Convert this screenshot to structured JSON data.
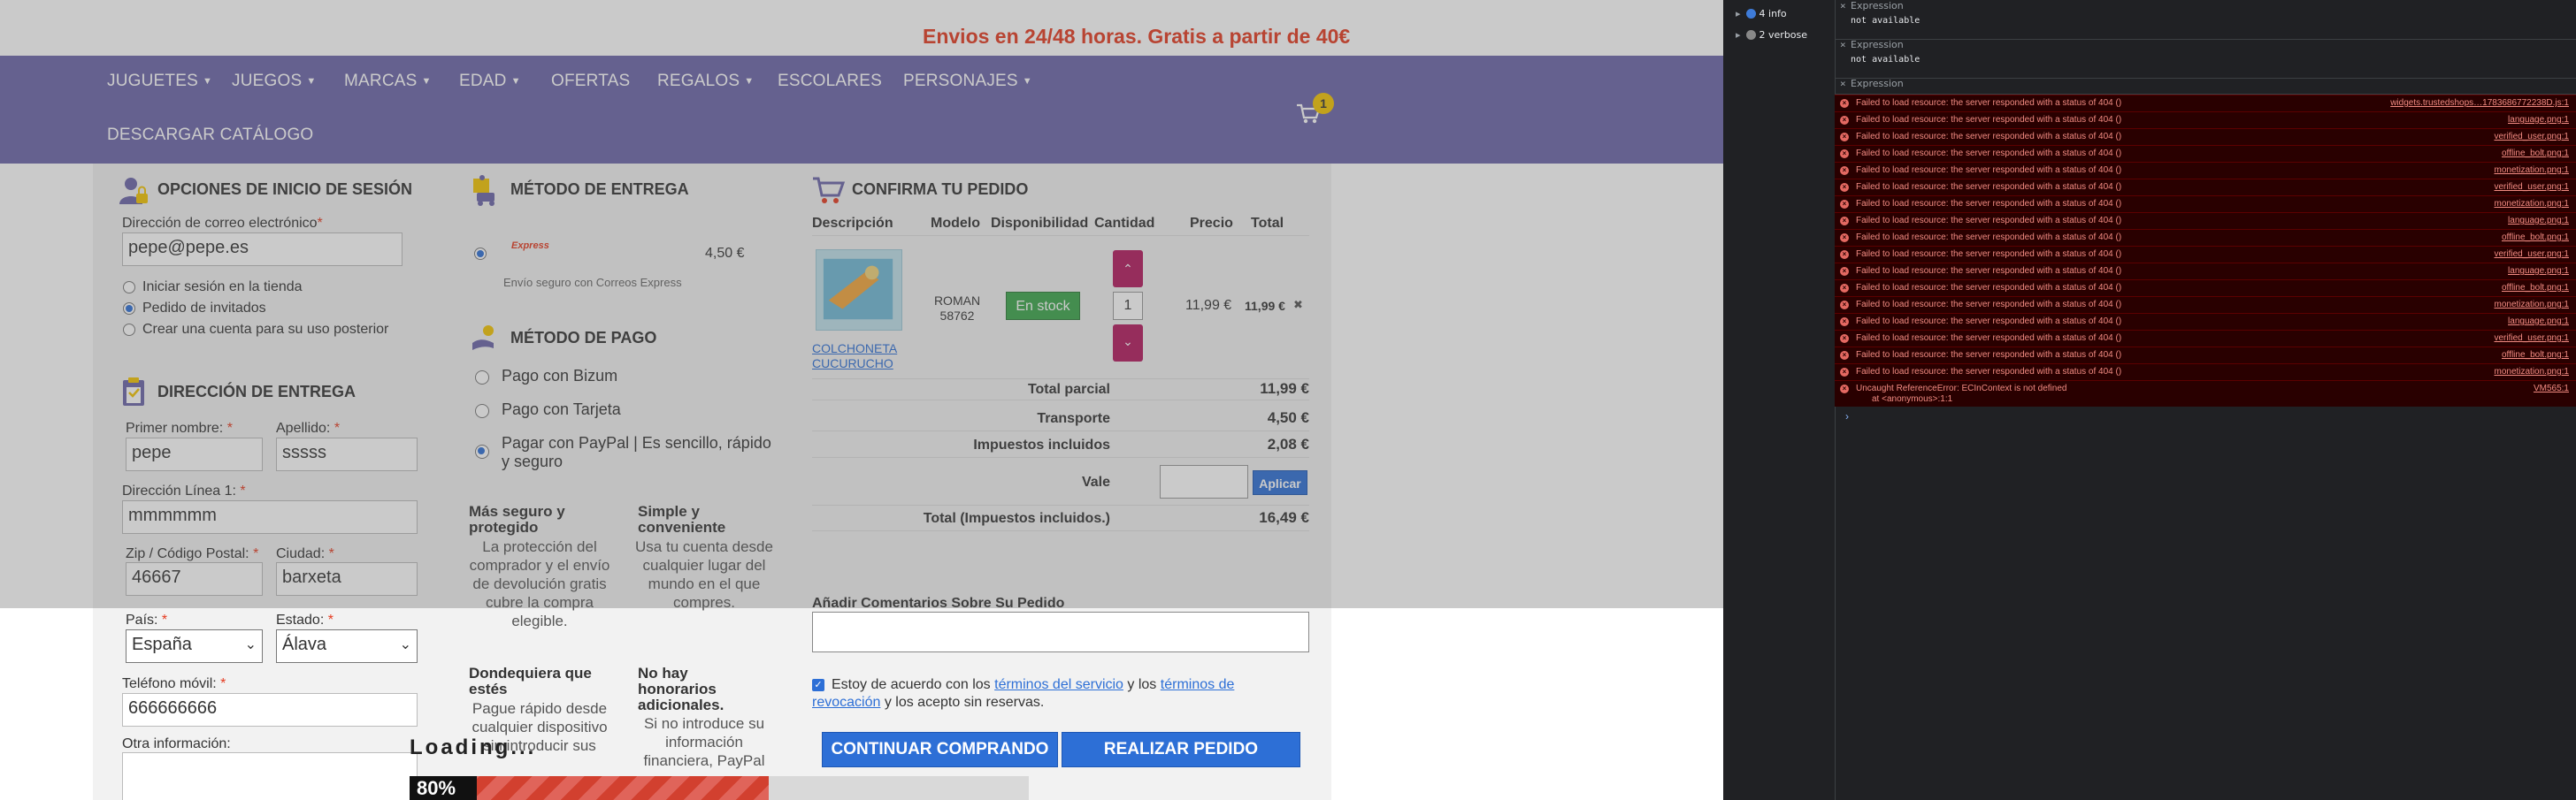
{
  "banner": {
    "text": "Envios en 24/48 horas. Gratis a partir de 40€"
  },
  "nav": {
    "items": [
      {
        "label": "JUGUETES",
        "caret": true
      },
      {
        "label": "JUEGOS",
        "caret": true
      },
      {
        "label": "MARCAS",
        "caret": true
      },
      {
        "label": "EDAD",
        "caret": true
      },
      {
        "label": "OFERTAS",
        "caret": false
      },
      {
        "label": "REGALOS",
        "caret": true
      },
      {
        "label": "ESCOLARES",
        "caret": false
      },
      {
        "label": "PERSONAJES",
        "caret": true
      },
      {
        "label": "DESCARGAR CATÁLOGO",
        "caret": false
      }
    ],
    "cart_count": "1"
  },
  "login": {
    "title": "OPCIONES DE INICIO DE SESIÓN",
    "email_label": "Dirección de correo electrónico",
    "email_value": "pepe@pepe.es",
    "options": [
      "Iniciar sesión en la tienda",
      "Pedido de invitados",
      "Crear una cuenta para su uso posterior"
    ],
    "selected": 1
  },
  "address": {
    "title": "DIRECCIÓN DE ENTREGA",
    "first_name_label": "Primer nombre:",
    "first_name": "pepe",
    "last_name_label": "Apellido:",
    "last_name": "sssss",
    "line1_label": "Dirección Línea 1:",
    "line1": "mmmmmm",
    "zip_label": "Zip / Código Postal:",
    "zip": "46667",
    "city_label": "Ciudad:",
    "city": "barxeta",
    "country_label": "País:",
    "country": "España",
    "state_label": "Estado:",
    "state": "Álava",
    "phone_label": "Teléfono móvil:",
    "phone": "666666666",
    "other_label": "Otra información:"
  },
  "delivery": {
    "title": "MÉTODO DE ENTREGA",
    "carrier_logo": "Express",
    "price": "4,50 €",
    "desc": "Envío seguro con Correos Express"
  },
  "payment": {
    "title": "MÉTODO DE PAGO",
    "options": [
      "Pago con Bizum",
      "Pago con Tarjeta",
      "Pagar con PayPal | Es sencillo, rápido y seguro"
    ],
    "selected": 2
  },
  "features": [
    {
      "title": "Más seguro y protegido",
      "text": "La protección del comprador y el envío de devolución gratis cubre la compra elegible."
    },
    {
      "title": "Simple y conveniente",
      "text": "Usa tu cuenta desde cualquier lugar del mundo en el que compres."
    },
    {
      "title": "Dondequiera que estés",
      "text": "Pague rápido desde cualquier dispositivo sin introducir sus"
    },
    {
      "title": "No hay honorarios adicionales.",
      "text": "Si no introduce su información financiera, PayPal"
    }
  ],
  "order": {
    "title": "CONFIRMA TU PEDIDO",
    "headers": [
      "Descripción",
      "Modelo",
      "Disponibilidad",
      "Cantidad",
      "Precio",
      "Total"
    ],
    "item": {
      "name": "COLCHONETA CUCURUCHO",
      "model": "ROMAN 58762",
      "stock": "En stock",
      "qty": "1",
      "price": "11,99 €",
      "total": "11,99 €",
      "remove_icon": "✖"
    },
    "totals": [
      {
        "label": "Total parcial",
        "value": "11,99 €"
      },
      {
        "label": "Transporte",
        "value": "4,50 €"
      },
      {
        "label": "Impuestos incluidos",
        "value": "2,08 €"
      }
    ],
    "voucher_label": "Vale",
    "apply_label": "Aplicar",
    "grand_total_label": "Total (Impuestos incluidos.)",
    "grand_total": "16,49 €",
    "comments_label": "Añadir Comentarios Sobre Su Pedido",
    "terms_prefix": "Estoy de acuerdo con los",
    "terms_link1": "términos del servicio",
    "terms_mid": "y los",
    "terms_link2": "términos de revocación",
    "terms_suffix": "y los acepto sin reservas.",
    "continue_label": "CONTINUAR COMPRANDO",
    "place_label": "REALIZAR PEDIDO"
  },
  "loading": {
    "text": "Loading...",
    "percent_label": "80%",
    "progress": 0.8
  },
  "devtools": {
    "filters": [
      {
        "label": "4 info"
      },
      {
        "label": "2 verbose"
      }
    ],
    "expressions": [
      {
        "title": "Expression",
        "value": "not available"
      },
      {
        "title": "Expression",
        "value": "not available"
      },
      {
        "title": "Expression",
        "value": ""
      }
    ],
    "errors": [
      {
        "msg": "Failed to load resource: the server responded with a status of 404 ()",
        "src": "widgets.trustedshops…1783686772238D.js:1"
      },
      {
        "msg": "Failed to load resource: the server responded with a status of 404 ()",
        "src": "language.png:1"
      },
      {
        "msg": "Failed to load resource: the server responded with a status of 404 ()",
        "src": "verified_user.png:1"
      },
      {
        "msg": "Failed to load resource: the server responded with a status of 404 ()",
        "src": "offline_bolt.png:1"
      },
      {
        "msg": "Failed to load resource: the server responded with a status of 404 ()",
        "src": "monetization.png:1"
      },
      {
        "msg": "Failed to load resource: the server responded with a status of 404 ()",
        "src": "verified_user.png:1"
      },
      {
        "msg": "Failed to load resource: the server responded with a status of 404 ()",
        "src": "monetization.png:1"
      },
      {
        "msg": "Failed to load resource: the server responded with a status of 404 ()",
        "src": "language.png:1"
      },
      {
        "msg": "Failed to load resource: the server responded with a status of 404 ()",
        "src": "offline_bolt.png:1"
      },
      {
        "msg": "Failed to load resource: the server responded with a status of 404 ()",
        "src": "verified_user.png:1"
      },
      {
        "msg": "Failed to load resource: the server responded with a status of 404 ()",
        "src": "language.png:1"
      },
      {
        "msg": "Failed to load resource: the server responded with a status of 404 ()",
        "src": "offline_bolt.png:1"
      },
      {
        "msg": "Failed to load resource: the server responded with a status of 404 ()",
        "src": "monetization.png:1"
      },
      {
        "msg": "Failed to load resource: the server responded with a status of 404 ()",
        "src": "language.png:1"
      },
      {
        "msg": "Failed to load resource: the server responded with a status of 404 ()",
        "src": "verified_user.png:1"
      },
      {
        "msg": "Failed to load resource: the server responded with a status of 404 ()",
        "src": "offline_bolt.png:1"
      },
      {
        "msg": "Failed to load resource: the server responded with a status of 404 ()",
        "src": "monetization.png:1"
      }
    ],
    "uncaught": {
      "msg": "Uncaught ReferenceError: ECInContext is not defined",
      "detail": "at <anonymous>:1:1",
      "src": "VM565:1"
    },
    "prompt": "›"
  },
  "colors": {
    "accent": "#2d6fd6",
    "brand_nav": "#6b65a8",
    "banner_text": "#e53a1f",
    "error_bg": "#290000"
  }
}
